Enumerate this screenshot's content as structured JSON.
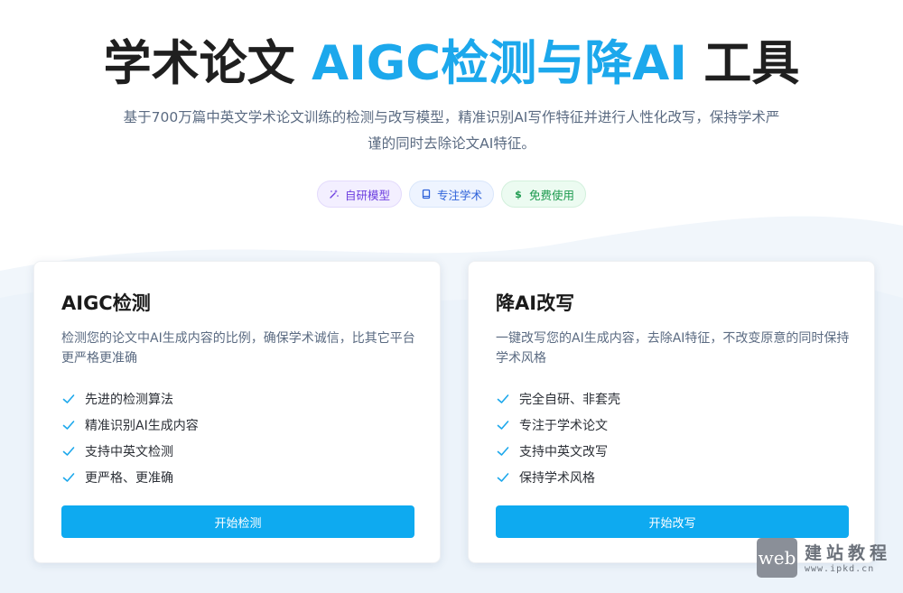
{
  "hero": {
    "title_main": "学术论文",
    "title_accent": "AIGC检测与降AI",
    "title_tail": "工具",
    "subtitle": "基于700万篇中英文学术论文训练的检测与改写模型，精准识别AI写作特征并进行人性化改写，保持学术严谨的同时去除论文AI特征。"
  },
  "tags": [
    {
      "label": "自研模型",
      "icon": "magic-wand-icon"
    },
    {
      "label": "专注学术",
      "icon": "book-icon"
    },
    {
      "label": "免费使用",
      "icon": "dollar-icon"
    }
  ],
  "cards": [
    {
      "title": "AIGC检测",
      "description": "检测您的论文中AI生成内容的比例，确保学术诚信，比其它平台更严格更准确",
      "features": [
        "先进的检测算法",
        "精准识别AI生成内容",
        "支持中英文检测",
        "更严格、更准确"
      ],
      "button": "开始检测"
    },
    {
      "title": "降AI改写",
      "description": "一键改写您的AI生成内容，去除AI特征，不改变原意的同时保持学术风格",
      "features": [
        "完全自研、非套壳",
        "专注于学术论文",
        "支持中英文改写",
        "保持学术风格"
      ],
      "button": "开始改写"
    }
  ],
  "watermark": {
    "box": "web",
    "cn": "建站教程",
    "url": "www.ipkd.cn"
  },
  "colors": {
    "accent": "#1ca8ec",
    "button": "#0eaaf0",
    "check": "#1ca8ec",
    "purple_tag": "#6d3fe0",
    "blue_tag": "#2e62d9",
    "green_tag": "#1c9a4e"
  }
}
